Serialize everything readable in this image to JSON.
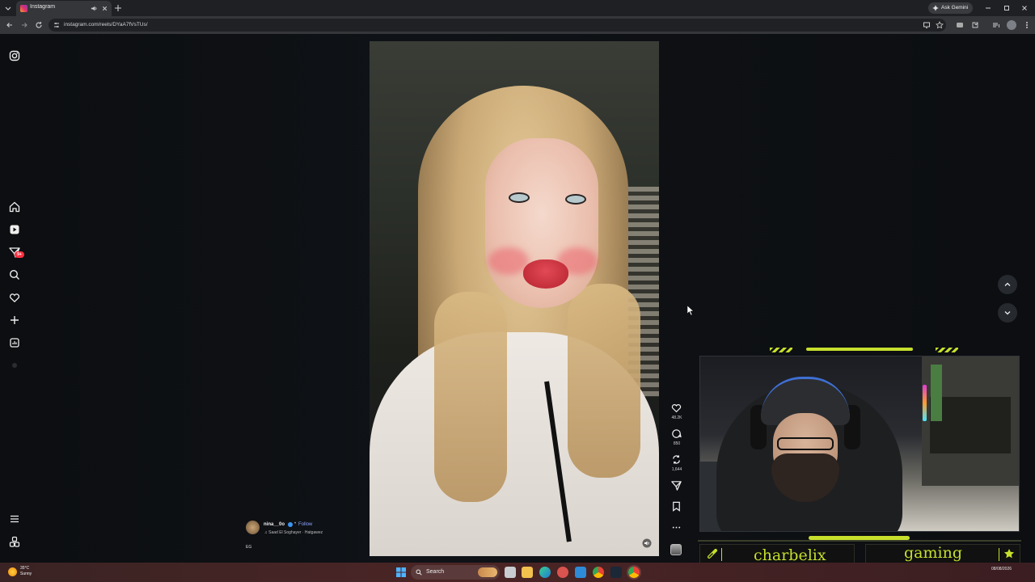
{
  "browser": {
    "tab_title": "Instagram",
    "url": "instagram.com/reels/DYaA7fVsTUs/",
    "gemini_label": "Ask Gemini"
  },
  "sidebar": {
    "notification_badge": "9+",
    "items": [
      {
        "name": "home",
        "icon": "home-icon"
      },
      {
        "name": "reels",
        "icon": "reels-icon"
      },
      {
        "name": "messages",
        "icon": "send-icon"
      },
      {
        "name": "search",
        "icon": "search-icon"
      },
      {
        "name": "notifications",
        "icon": "heart-icon"
      },
      {
        "name": "create",
        "icon": "plus-icon"
      },
      {
        "name": "dashboard",
        "icon": "dashboard-icon"
      },
      {
        "name": "more",
        "icon": "menu-icon"
      },
      {
        "name": "also-from-meta",
        "icon": "meta-icon"
      }
    ]
  },
  "reel": {
    "author": "nina__0o",
    "follow_label": "Follow",
    "separator": "•",
    "audio": "Saad El Soghayer · Hatgawez",
    "caption": "EG"
  },
  "actions": {
    "likes": "48.2K",
    "comments": "850",
    "reposts": "1,644"
  },
  "overlay": {
    "left_label": "charbelix",
    "right_label": "gaming",
    "accent": "#c7df2c"
  },
  "taskbar": {
    "weather_temp": "35°C",
    "weather_desc": "Sunny",
    "search_label": "Search",
    "date": "08/08/2026"
  }
}
